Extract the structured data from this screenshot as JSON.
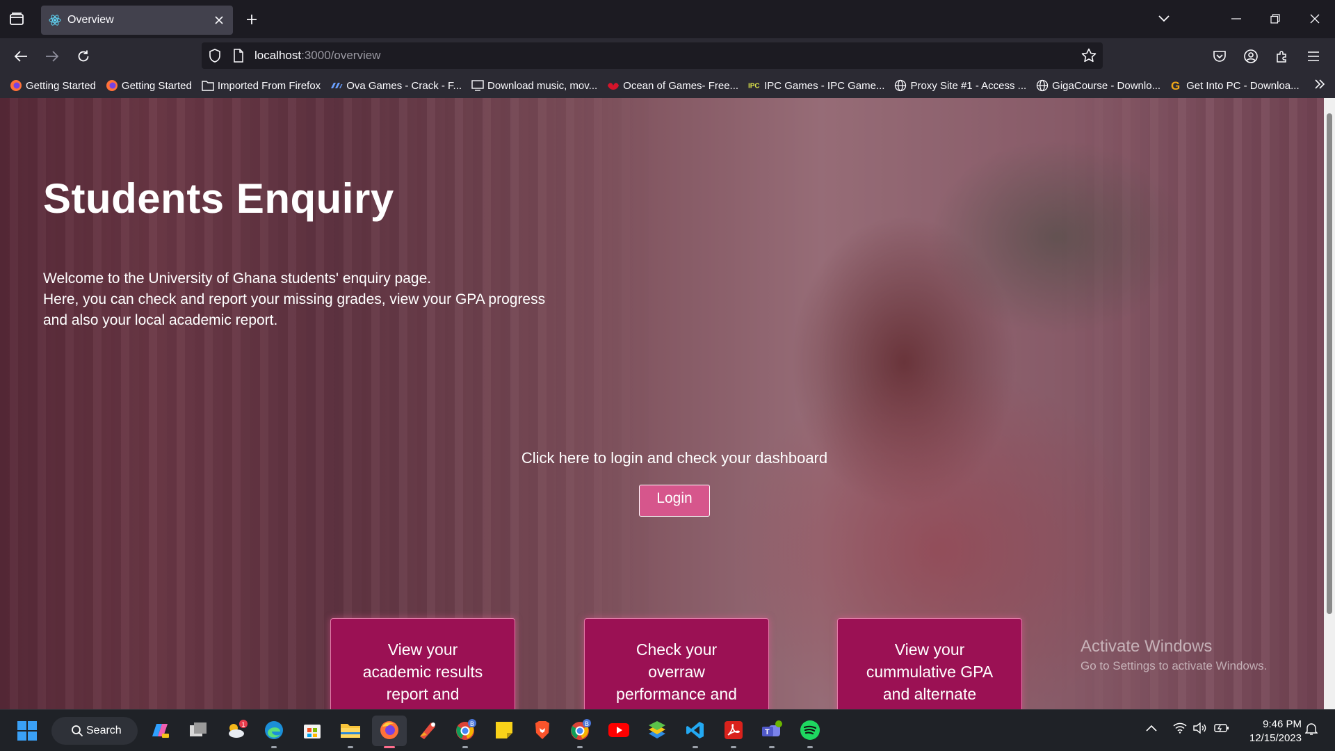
{
  "browser": {
    "tab_title": "Overview",
    "url_host": "localhost",
    "url_path": ":3000/overview",
    "bookmarks": [
      {
        "label": "Getting Started",
        "icon": "firefox-icon"
      },
      {
        "label": "Getting Started",
        "icon": "firefox-icon"
      },
      {
        "label": "Imported From Firefox",
        "icon": "folder-icon"
      },
      {
        "label": "Ova Games - Crack - F...",
        "icon": "ova-games-icon"
      },
      {
        "label": "Download music, mov...",
        "icon": "download-site-icon"
      },
      {
        "label": "Ocean of Games- Free...",
        "icon": "ocean-of-games-icon"
      },
      {
        "label": "IPC Games - IPC Game...",
        "icon": "ipc-games-icon"
      },
      {
        "label": "Proxy Site #1 - Access ...",
        "icon": "globe-icon"
      },
      {
        "label": "GigaCourse - Downlo...",
        "icon": "globe-icon"
      },
      {
        "label": "Get Into PC - Downloa...",
        "icon": "getintopc-icon"
      }
    ]
  },
  "hero": {
    "title": "Students Enquiry",
    "lines": [
      "Welcome to the University of Ghana students' enquiry page.",
      "Here, you can check and report your missing grades, view your GPA progress",
      "and also your local academic report."
    ]
  },
  "login": {
    "prompt": "Click here to login and check your dashboard",
    "button_label": "Login"
  },
  "cards": [
    {
      "text": "View your academic results report and"
    },
    {
      "text": "Check your overraw performance and"
    },
    {
      "text": "View your cummulative GPA and alternate"
    }
  ],
  "watermark": {
    "line1": "Activate Windows",
    "line2": "Go to Settings to activate Windows."
  },
  "taskbar": {
    "search_label": "Search",
    "time": "9:46 PM",
    "date": "12/15/2023",
    "badges": {
      "weather": "1",
      "chrome": "B",
      "chrome2": "B"
    }
  },
  "colors": {
    "accent_pink": "#d6568c",
    "card_magenta": "#9b1154",
    "overlay": "#6e1937"
  }
}
